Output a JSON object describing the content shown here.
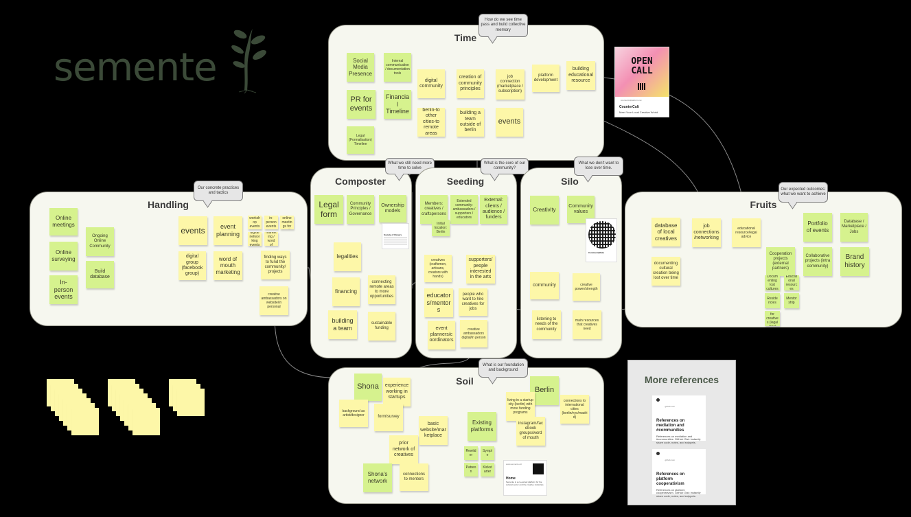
{
  "logo": {
    "text": "semente"
  },
  "panels": {
    "time": "Time",
    "handling": "Handling",
    "composter": "Composter",
    "seeding": "Seeding",
    "silo": "Silo",
    "fruits": "Fruits",
    "soil": "Soil"
  },
  "bubbles": {
    "time": "How do we see time pass and build collective memory",
    "handling": "Our concrete practices and tactics",
    "composter": "What we still need more time to solve",
    "seeding": "What is the core of our community?",
    "silo": "What we don't want to lose over time.",
    "fruits": "Our expected outcomes: what we want to achieve",
    "soil": "What is our foundation and background"
  },
  "time": {
    "social_media": "Social Media Presence",
    "internal_comm": "Internal communication / documentation tools",
    "pr_events": "PR for events",
    "financial_timeline": "Financial Timeline",
    "legal_timeline": "Legal (Formalisation) Timeline",
    "digital_community": "digital community",
    "community_principles": "creation of community principles",
    "job_connection": "job connection (marketplace / subscription)",
    "platform_development": "platform development",
    "educational_resource": "building educational resource",
    "berlin_cities": "berlin-to other cities-to remote areas",
    "building_team_outside": "building a team outside of berlin",
    "events": "events"
  },
  "open_call": {
    "badge": "OPEN CALL",
    "site": "countercultplatform.net",
    "title": "CounterCult",
    "desc": "Meet Your Local Creative World"
  },
  "handling": {
    "online_meetings": "Online meetings",
    "online_surveying": "Online surveying",
    "inperson_events": "In-person events",
    "ongoing_online": "Ongoing Online Community",
    "build_database": "Build database",
    "events": "events",
    "event_planning": "event planning",
    "workshop_events": "workshop events",
    "inperson_events_small": "in-person events",
    "small_note": "ongoing online meetings for creatives",
    "digital_networking": "digital networking events",
    "fun_marketing": "fun marketing / word of mouth",
    "digital_group": "digital group (facebook group)",
    "word_of_mouth": "word of mouth marketing",
    "finding_ways": "finding ways to fund the community/ projects",
    "creative_ambassadors": "creative ambassadors on website/in personal"
  },
  "composter": {
    "legal_form": "Legal form",
    "community_principles": "Community Principles / Governance",
    "ownership_models": "Ownership models",
    "society_card_title": "Society of Owners",
    "legalities": "legalities",
    "financing": "financing",
    "connecting_remote": "connecting remote areas to more opportunities",
    "building_team": "building a team",
    "sustainable_funding": "sustainable funding"
  },
  "seeding": {
    "members": "Members: creatives / craftspersons",
    "extended": "Extended community: ambassadors / supporters / educators",
    "external": "External: clients / audience / funders",
    "initial_location": "Initial location: Berlin",
    "creatives": "creatives (craftsmen, artisans, creators with hands)",
    "supporters": "supporters/ people interested in the arts",
    "educators": "educators/mentors",
    "hire_creatives": "people who want to hire creatives for jobs",
    "event_planners": "event planners/coordinators",
    "creative_ambassadors": "creative ambassadors digital/in person"
  },
  "silo": {
    "creativity": "Creativity",
    "community_values": "Community values",
    "qr_label": "CommunityRule",
    "community": "community",
    "creative_power": "creative power/strength",
    "listening": "listening to needs of the community",
    "main_resources": "main resources that creatives need"
  },
  "fruits": {
    "database": "database of local creatives",
    "job_connections": "job connections/networking",
    "educational": "educational resource/legal advice",
    "portfolio": "Portfolio of events",
    "database_marketplace": "Database / Marketplace / Jobs",
    "documenting": "documenting cultural creation being lost over time",
    "cooperation": "Cooperation projects (external partners)",
    "collaborative": "Collaborative projects (intra community)",
    "brand_history": "Brand history",
    "documenting_small": "Documenting lost cultures",
    "educational_small": "Educational resources",
    "residencies": "Residencies",
    "mentorship": "Mentorship",
    "advice": "Advice for creatives (legal / tax)"
  },
  "soil": {
    "shona": "Shona",
    "experience_startups": "experience working in startups",
    "berlin": "Berlin",
    "living_startup": "living in a startup city (berlin) with more funding programs",
    "intl_cities": "connections to international cities (berlin/nyc/madrid)",
    "background_artist": "background as artist/designer",
    "form_survey": "form/survey",
    "basic_website": "basic website/marketplace",
    "existing_platforms": "Existing platforms",
    "instagram": "instagram/facebook groups/word of mouth",
    "prior_network": "prior network of creatives",
    "shonas_network": "Shona's network",
    "connections_mentors": "connections to mentors",
    "p1": "Rewilder",
    "p2": "Symple",
    "p3": "Patreon",
    "p4": "Kickstarter",
    "home_site": "www.semente.art",
    "home_title": "Home",
    "home_desc": "Semente is a co-owned platform for the cultural sector and the creative industries."
  },
  "references": {
    "title": "More references",
    "card1_site": "github.com",
    "card1_title": "References on mediation and #communities",
    "card1_desc": "References on mediation and #communities. GitHub Gist: instantly share code, notes, and snippets.",
    "card2_site": "github.com",
    "card2_title": "References on platform cooperativism",
    "card2_desc": "References on platform cooperativism. GitHub Gist: instantly share code, notes, and snippets."
  },
  "colors": {
    "background": "#000000",
    "panel": "#f6f7ef",
    "sticky_yellow": "#fdf7a8",
    "sticky_green": "#d6f28e",
    "logo": "#3b4a38",
    "references_panel": "#e8e8e8"
  }
}
